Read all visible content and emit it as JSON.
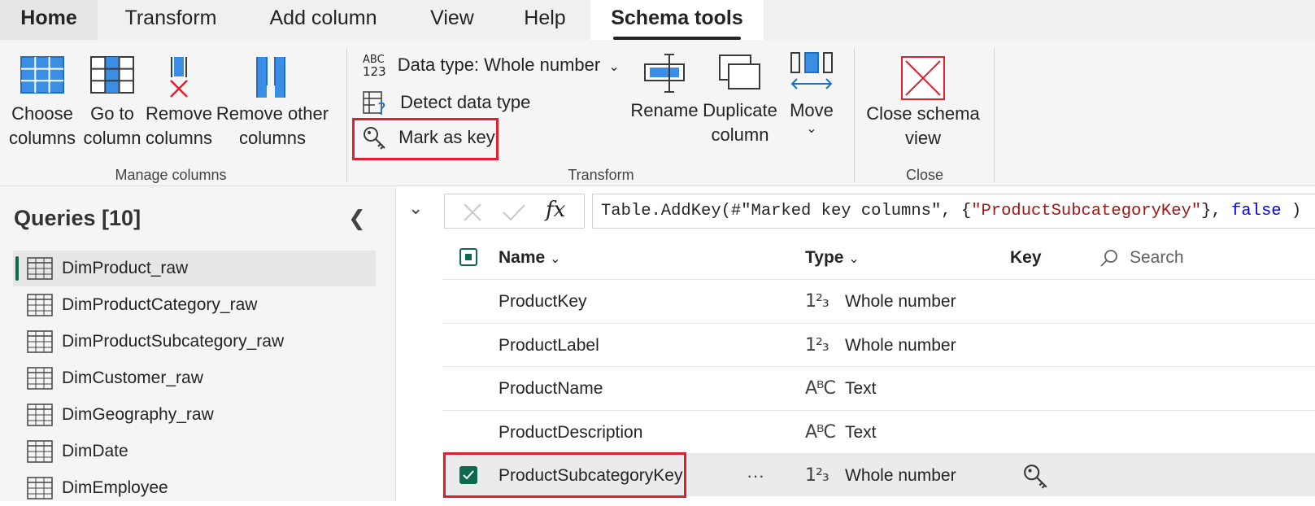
{
  "tabs": [
    {
      "label": "Home"
    },
    {
      "label": "Transform"
    },
    {
      "label": "Add column"
    },
    {
      "label": "View"
    },
    {
      "label": "Help"
    },
    {
      "label": "Schema tools",
      "active": true
    }
  ],
  "ribbon": {
    "manage_columns": {
      "group_label": "Manage columns",
      "choose_columns": {
        "line1": "Choose",
        "line2": "columns",
        "icon": "choose-columns-icon"
      },
      "go_to_column": {
        "line1": "Go to",
        "line2": "column",
        "icon": "go-to-column-icon"
      },
      "remove_columns": {
        "line1": "Remove",
        "line2": "columns",
        "icon": "remove-columns-icon"
      },
      "remove_other_columns": {
        "line1": "Remove other",
        "line2": "columns",
        "icon": "remove-other-columns-icon"
      }
    },
    "transform": {
      "group_label": "Transform",
      "data_type": {
        "label": "Data type: Whole number",
        "icon_top": "ABC",
        "icon_bottom": "123"
      },
      "detect_data_type": {
        "label": "Detect data type"
      },
      "mark_as_key": {
        "label": "Mark as key"
      },
      "rename": {
        "label": "Rename"
      },
      "duplicate_column": {
        "line1": "Duplicate",
        "line2": "column"
      },
      "move": {
        "label": "Move",
        "chevron": "⌄"
      }
    },
    "close": {
      "group_label": "Close",
      "close_schema_view": {
        "line1": "Close schema",
        "line2": "view"
      }
    }
  },
  "queries": {
    "title": "Queries [10]",
    "items": [
      {
        "label": "DimProduct_raw",
        "selected": true
      },
      {
        "label": "DimProductCategory_raw"
      },
      {
        "label": "DimProductSubcategory_raw"
      },
      {
        "label": "DimCustomer_raw"
      },
      {
        "label": "DimGeography_raw"
      },
      {
        "label": "DimDate"
      },
      {
        "label": "DimEmployee"
      }
    ]
  },
  "formula_bar": {
    "fx": "fx",
    "part1": "Table.AddKey(#\"Marked key columns\", {",
    "part2": "\"ProductSubcategoryKey\"",
    "part3": "}, ",
    "part4": "false",
    "part5": " )"
  },
  "grid": {
    "headers": {
      "name": "Name",
      "type": "Type",
      "key": "Key",
      "search_placeholder": "Search"
    },
    "rows": [
      {
        "name": "ProductKey",
        "type_icon": "1²₃",
        "type": "Whole number",
        "is_key": false,
        "selected": false
      },
      {
        "name": "ProductLabel",
        "type_icon": "1²₃",
        "type": "Whole number",
        "is_key": false,
        "selected": false
      },
      {
        "name": "ProductName",
        "type_icon": "AᴮC",
        "type": "Text",
        "is_key": false,
        "selected": false
      },
      {
        "name": "ProductDescription",
        "type_icon": "AᴮC",
        "type": "Text",
        "is_key": false,
        "selected": false
      },
      {
        "name": "ProductSubcategoryKey",
        "type_icon": "1²₃",
        "type": "Whole number",
        "is_key": true,
        "selected": true,
        "more": "···"
      }
    ]
  },
  "colors": {
    "accent_green": "#0e6a4e",
    "highlight_red": "#e0202e",
    "icon_blue": "#3a8ee6",
    "remove_red": "#e0202e"
  }
}
